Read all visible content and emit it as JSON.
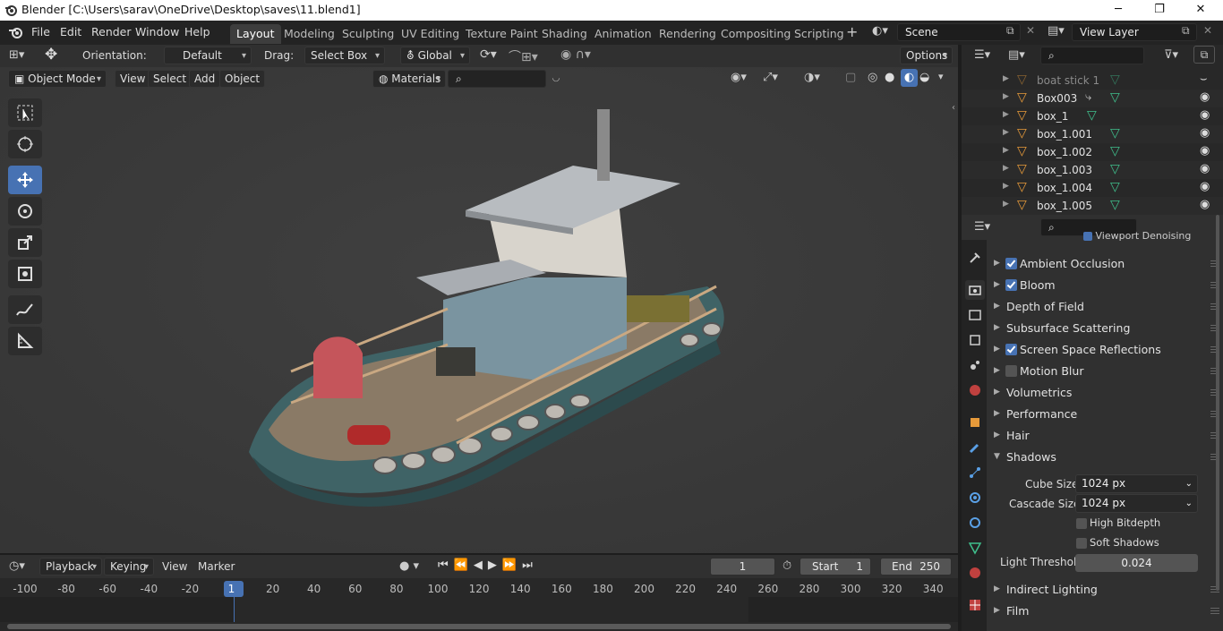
{
  "window": {
    "title": "Blender [C:\\Users\\sarav\\OneDrive\\Desktop\\saves\\11.blend1]"
  },
  "menu": [
    "File",
    "Edit",
    "Render",
    "Window",
    "Help"
  ],
  "workspaces": [
    "Layout",
    "Modeling",
    "Sculpting",
    "UV Editing",
    "Texture Paint",
    "Shading",
    "Animation",
    "Rendering",
    "Compositing",
    "Scripting"
  ],
  "active_workspace": "Layout",
  "scene": {
    "label": "Scene"
  },
  "view_layer": {
    "label": "View Layer"
  },
  "toolheader": {
    "orientation_label": "Orientation:",
    "orientation_value": "Default",
    "drag_label": "Drag:",
    "drag_value": "Select Box",
    "transform_orientation": "Global",
    "options_label": "Options"
  },
  "viewheader": {
    "mode": "Object Mode",
    "view": "View",
    "select": "Select",
    "add": "Add",
    "object": "Object",
    "materials": "Materials"
  },
  "outliner": {
    "rows": [
      "boat stick 1",
      "Box003",
      "box_1",
      "box_1.001",
      "box_1.002",
      "box_1.003",
      "box_1.004",
      "box_1.005"
    ]
  },
  "properties": {
    "partial_top": "Viewport Denoising",
    "panels": [
      {
        "label": "Ambient Occlusion",
        "checkbox": true,
        "checked": true
      },
      {
        "label": "Bloom",
        "checkbox": true,
        "checked": true
      },
      {
        "label": "Depth of Field",
        "checkbox": false
      },
      {
        "label": "Subsurface Scattering",
        "checkbox": false
      },
      {
        "label": "Screen Space Reflections",
        "checkbox": true,
        "checked": true
      },
      {
        "label": "Motion Blur",
        "checkbox": true,
        "checked": false
      },
      {
        "label": "Volumetrics",
        "checkbox": false
      },
      {
        "label": "Performance",
        "checkbox": false
      },
      {
        "label": "Hair",
        "checkbox": false
      },
      {
        "label": "Shadows",
        "checkbox": false,
        "expanded": true
      }
    ],
    "shadows": {
      "cube_size_label": "Cube Size",
      "cube_size": "1024 px",
      "cascade_size_label": "Cascade Size",
      "cascade_size": "1024 px",
      "high_bitdepth": "High Bitdepth",
      "soft_shadows": "Soft Shadows",
      "light_threshold_label": "Light Threshold",
      "light_threshold": "0.024"
    },
    "after": [
      "Indirect Lighting",
      "Film"
    ]
  },
  "timeline": {
    "playback": "Playback",
    "keying": "Keying",
    "view": "View",
    "marker": "Marker",
    "current_frame": "1",
    "start_label": "Start",
    "start": "1",
    "end_label": "End",
    "end": "250",
    "ticks": [
      "-100",
      "-80",
      "-60",
      "-40",
      "-20",
      "1",
      "20",
      "40",
      "60",
      "80",
      "100",
      "120",
      "140",
      "160",
      "180",
      "200",
      "220",
      "240",
      "260",
      "280",
      "300",
      "320",
      "340"
    ]
  },
  "colors": {
    "accent": "#4772b3",
    "header": "#303030",
    "panel": "#282828",
    "viewport": "#393939"
  }
}
